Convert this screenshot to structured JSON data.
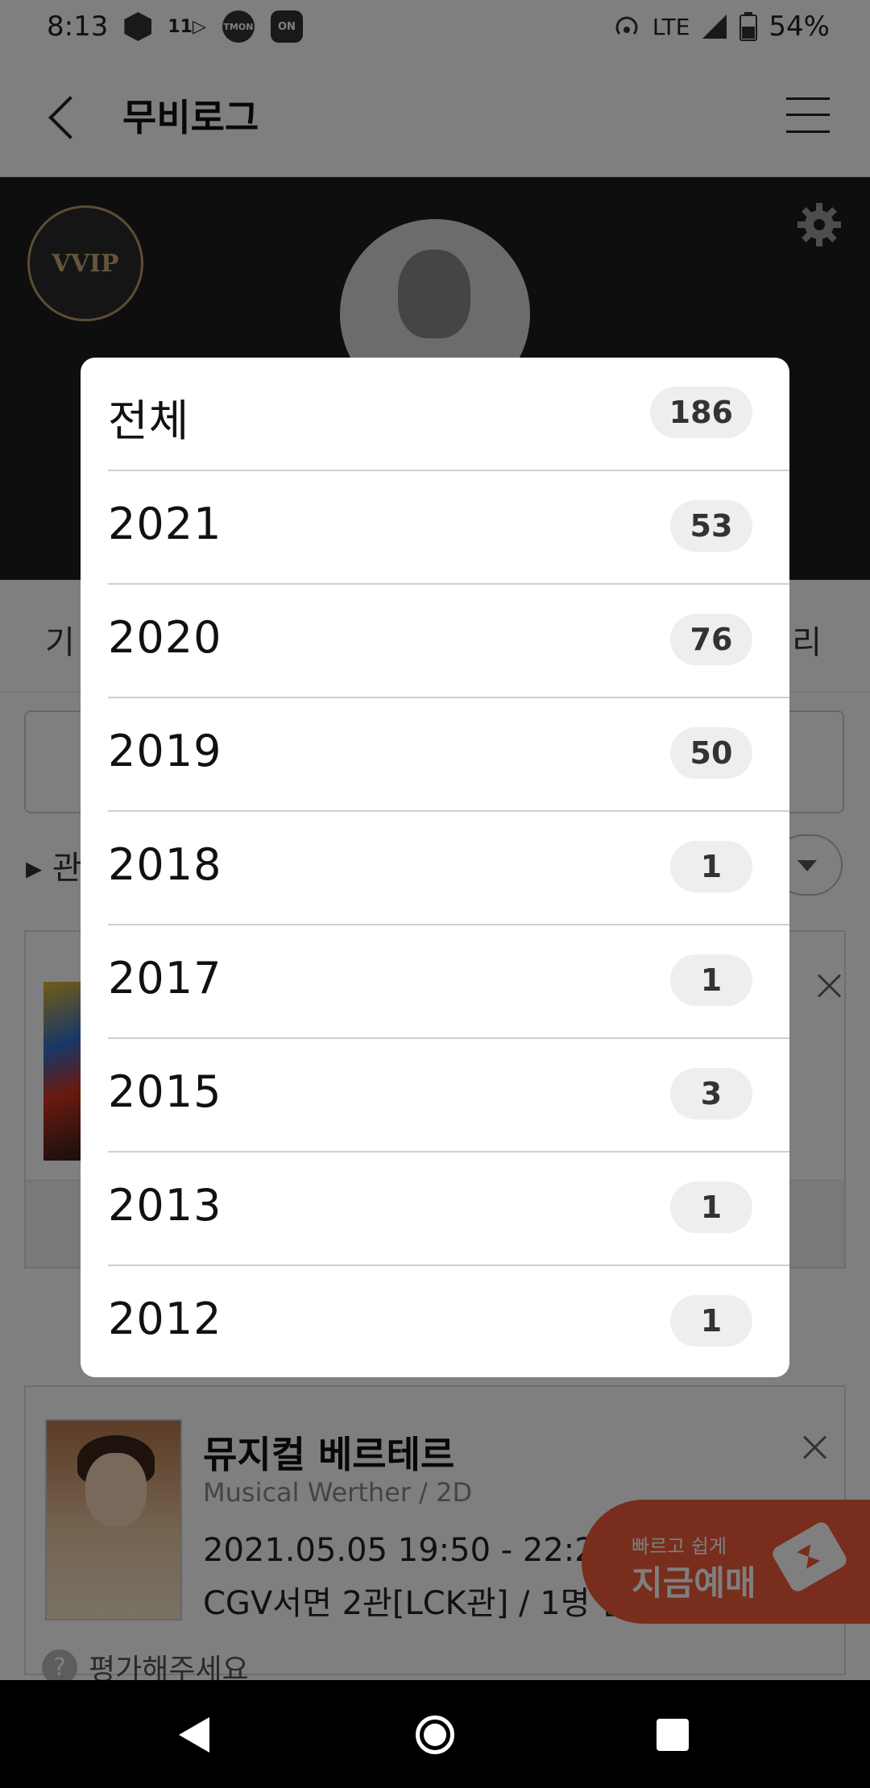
{
  "status_bar": {
    "time": "8:13",
    "icons_left": [
      "package-icon",
      "11st-icon",
      "tmon-icon",
      "on-icon"
    ],
    "icons_right": [
      "hotspot-icon",
      "lte-icon",
      "signal-icon",
      "battery-icon"
    ],
    "network": "LTE",
    "battery": "54%",
    "tmon_text": "TMON",
    "on_text": "ON",
    "eleven_text": "11▷"
  },
  "app_bar": {
    "title": "무비로그",
    "icons": [
      "back-icon",
      "menu-icon"
    ]
  },
  "profile": {
    "badge": "VVIP",
    "icons": [
      "settings-gear-icon",
      "avatar-silhouette"
    ]
  },
  "tabs": {
    "left_partial": "기",
    "right_partial": "리"
  },
  "sort": {
    "label_partial": "관"
  },
  "movie_card": {
    "title": "뮤지컬 베르테르",
    "subtitle": "Musical Werther / 2D",
    "datetime": "2021.05.05 19:50 - 22:25",
    "venue": "CGV서면 2관[LCK관] / 1명 관람",
    "rate_prompt": "평가해주세요"
  },
  "fab": {
    "top": "빠르고 쉽게",
    "main": "지금예매"
  },
  "year_filter": {
    "items": [
      {
        "label": "전체",
        "count": "186"
      },
      {
        "label": "2021",
        "count": "53"
      },
      {
        "label": "2020",
        "count": "76"
      },
      {
        "label": "2019",
        "count": "50"
      },
      {
        "label": "2018",
        "count": "1"
      },
      {
        "label": "2017",
        "count": "1"
      },
      {
        "label": "2015",
        "count": "3"
      },
      {
        "label": "2013",
        "count": "1"
      },
      {
        "label": "2012",
        "count": "1"
      }
    ]
  },
  "colors": {
    "accent": "#f05a3a",
    "header_dark": "#1c1c1c",
    "vvip_gold": "#c9ab78",
    "badge_bg": "#eeeeee"
  }
}
